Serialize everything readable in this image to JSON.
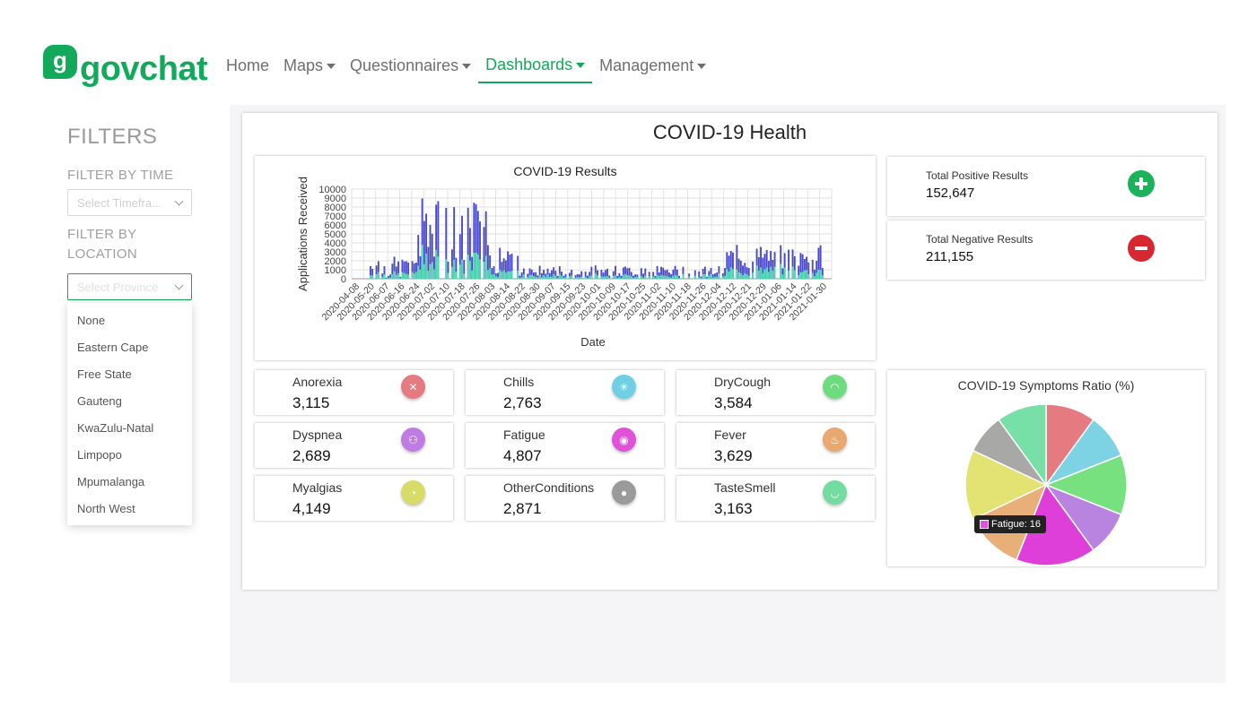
{
  "brand": {
    "badge": "g",
    "name": "govchat",
    "color": "#12a95a"
  },
  "nav": [
    {
      "label": "Home",
      "dropdown": false,
      "active": false
    },
    {
      "label": "Maps",
      "dropdown": true,
      "active": false
    },
    {
      "label": "Questionnaires",
      "dropdown": true,
      "active": false
    },
    {
      "label": "Dashboards",
      "dropdown": true,
      "active": true
    },
    {
      "label": "Management",
      "dropdown": true,
      "active": false
    }
  ],
  "sidebar": {
    "title": "FILTERS",
    "time_label": "FILTER BY TIME",
    "time_placeholder": "Select Timefra...",
    "location_label_1": "FILTER BY",
    "location_label_2": "LOCATION",
    "province_placeholder": "Select Province",
    "province_options": [
      "None",
      "Eastern Cape",
      "Free State",
      "Gauteng",
      "KwaZulu-Natal",
      "Limpopo",
      "Mpumalanga",
      "North West"
    ]
  },
  "dashboard": {
    "title": "COVID-19 Health",
    "totals": {
      "positive": {
        "label": "Total Positive Results",
        "value": "152,647",
        "icon": "plus-circle-icon",
        "color": "#1ab35a"
      },
      "negative": {
        "label": "Total Negative Results",
        "value": "211,155",
        "icon": "minus-circle-icon",
        "color": "#d8282f"
      }
    },
    "symptoms": [
      {
        "label": "Anorexia",
        "value": "3,115",
        "icon": "no-food-icon",
        "color": "#e57a80"
      },
      {
        "label": "Chills",
        "value": "2,763",
        "icon": "snowflake-icon",
        "color": "#6fd0e4"
      },
      {
        "label": "DryCough",
        "value": "3,584",
        "icon": "cough-icon",
        "color": "#6ddc7e"
      },
      {
        "label": "Dyspnea",
        "value": "2,689",
        "icon": "breathing-icon",
        "color": "#c07ce2"
      },
      {
        "label": "Fatigue",
        "value": "4,807",
        "icon": "tired-eye-icon",
        "color": "#e052d8"
      },
      {
        "label": "Fever",
        "value": "3,629",
        "icon": "flame-icon",
        "color": "#e8a86e"
      },
      {
        "label": "Myalgias",
        "value": "4,149",
        "icon": "muscle-icon",
        "color": "#d8db66"
      },
      {
        "label": "OtherConditions",
        "value": "2,871",
        "icon": "person-icon",
        "color": "#9a9a9a"
      },
      {
        "label": "TasteSmell",
        "value": "3,163",
        "icon": "lips-icon",
        "color": "#73dca0"
      }
    ],
    "tooltip": {
      "text": "Fatigue: 16",
      "color": "#e052d8"
    }
  },
  "chart_data": [
    {
      "type": "bar",
      "title": "COVID-19 Results",
      "xlabel": "Date",
      "ylabel": "Applications Received",
      "ylim": [
        0,
        10000
      ],
      "yticks": [
        0,
        1000,
        2000,
        3000,
        4000,
        5000,
        6000,
        7000,
        8000,
        9000,
        10000
      ],
      "xticks": [
        "2020-04-08",
        "2020-05-20",
        "2020-06-07",
        "2020-06-16",
        "2020-06-24",
        "2020-07-02",
        "2020-07-10",
        "2020-07-18",
        "2020-07-26",
        "2020-08-03",
        "2020-08-14",
        "2020-08-22",
        "2020-08-30",
        "2020-09-07",
        "2020-09-15",
        "2020-09-23",
        "2020-10-01",
        "2020-10-09",
        "2020-10-17",
        "2020-10-25",
        "2020-11-02",
        "2020-11-10",
        "2020-11-18",
        "2020-11-26",
        "2020-12-04",
        "2020-12-12",
        "2020-12-21",
        "2020-12-29",
        "2021-01-06",
        "2021-01-14",
        "2021-01-22",
        "2021-01-30"
      ],
      "grid": true,
      "stacked": true,
      "series_colors": [
        "#52d6b3",
        "#4a4ac9"
      ],
      "segments": [
        {
          "start": "2020-06-16",
          "end": "2020-07-02",
          "total": [
            0,
            1500,
            2500
          ]
        },
        {
          "start": "2020-07-02",
          "end": "2020-07-10",
          "total": [
            1500,
            2200
          ]
        },
        {
          "start": "2020-07-10",
          "end": "2020-08-14",
          "total": [
            1500,
            9200
          ]
        },
        {
          "start": "2020-08-14",
          "end": "2020-08-30",
          "total": [
            500,
            5000
          ]
        },
        {
          "start": "2020-08-30",
          "end": "2020-12-12",
          "total": [
            200,
            1500
          ]
        },
        {
          "start": "2020-12-12",
          "end": "2021-01-30",
          "total": [
            1000,
            3800
          ]
        }
      ]
    },
    {
      "type": "pie",
      "title": "COVID-19 Symptoms Ratio (%)",
      "categories": [
        "Anorexia",
        "Chills",
        "DryCough",
        "Dyspnea",
        "Fatigue",
        "Fever",
        "Myalgias",
        "OtherConditions",
        "TasteSmell"
      ],
      "values": [
        10,
        9,
        12,
        9,
        16,
        12,
        14,
        8,
        10
      ],
      "colors": [
        "#e57a80",
        "#7dd3e3",
        "#77e07f",
        "#b983e0",
        "#de3fd8",
        "#e8af78",
        "#e3e374",
        "#a8a9a7",
        "#77e0a7"
      ]
    }
  ]
}
